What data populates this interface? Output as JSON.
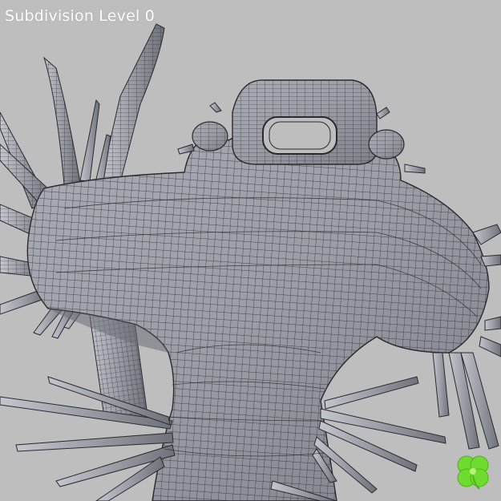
{
  "viewport": {
    "overlay_text": "Subdivision Level 0",
    "background_color": "#bebebe",
    "mesh_fill_color": "#9a9ca6",
    "wire_color": "#2a2a2e",
    "logo_icon": "four-leaf-clover-icon",
    "logo_color": "#6ddc2f"
  }
}
